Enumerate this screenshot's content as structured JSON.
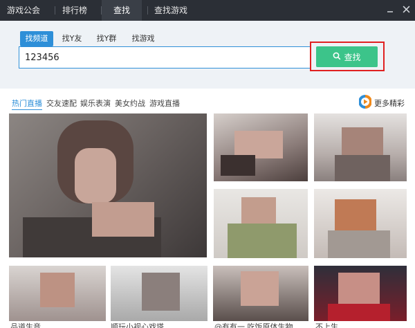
{
  "nav": {
    "tabs": [
      {
        "label": "游戏公会"
      },
      {
        "label": "排行榜"
      },
      {
        "label": "查找",
        "active": true
      },
      {
        "label": "查找游戏"
      }
    ],
    "minimize_icon": "minimize-icon",
    "close_icon": "close-icon"
  },
  "search": {
    "tabs": [
      {
        "label": "找频道",
        "active": true
      },
      {
        "label": "找Y友"
      },
      {
        "label": "找Y群"
      },
      {
        "label": "找游戏"
      }
    ],
    "input_value": "123456",
    "button_label": "查找",
    "button_icon": "search-icon",
    "accent_color": "#2e8fd8",
    "button_color": "#3cc48a",
    "highlight_color": "#e02020"
  },
  "categories": {
    "items": [
      {
        "label": "热门直播",
        "active": true
      },
      {
        "label": "交友速配"
      },
      {
        "label": "娱乐表演"
      },
      {
        "label": "美女约战"
      },
      {
        "label": "游戏直播"
      }
    ],
    "more_label": "更多精彩",
    "more_icon": "play-circle-icon"
  },
  "thumbnails": {
    "captions": [
      "品道生音",
      "顺玩小视心戏塔",
      "@有有一 吃饭原体生物",
      "不上生"
    ]
  }
}
